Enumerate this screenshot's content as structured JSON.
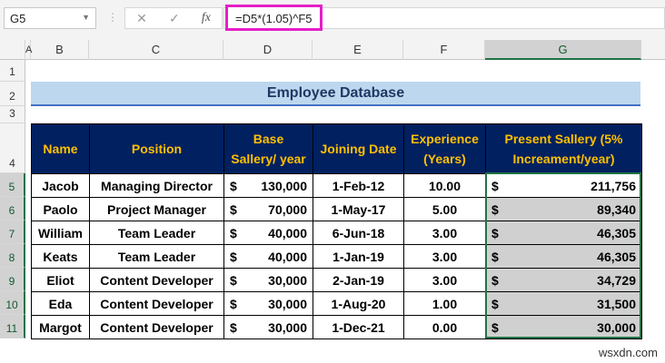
{
  "formula_bar": {
    "name_box": "G5",
    "cancel": "✕",
    "enter": "✓",
    "fx": "fx",
    "formula": "=D5*(1.05)^F5"
  },
  "columns": [
    "A",
    "B",
    "C",
    "D",
    "E",
    "F",
    "G"
  ],
  "rows": [
    "1",
    "2",
    "3",
    "4",
    "5",
    "6",
    "7",
    "8",
    "9",
    "10",
    "11"
  ],
  "title": "Employee Database",
  "headers": [
    "Name",
    "Position",
    "Base Sallery/ year",
    "Joining Date",
    "Experience (Years)",
    "Present Sallery (5% Increament/year)"
  ],
  "currency": "$",
  "data": [
    [
      "Jacob",
      "Managing Director",
      "130,000",
      "1-Feb-12",
      "10.00",
      "211,756"
    ],
    [
      "Paolo",
      "Project Manager",
      "70,000",
      "1-May-17",
      "5.00",
      "89,340"
    ],
    [
      "William",
      "Team Leader",
      "40,000",
      "6-Jun-18",
      "3.00",
      "46,305"
    ],
    [
      "Keats",
      "Team Leader",
      "40,000",
      "1-Jan-19",
      "3.00",
      "46,305"
    ],
    [
      "Eliot",
      "Content Developer",
      "30,000",
      "2-Jan-19",
      "3.00",
      "34,729"
    ],
    [
      "Eda",
      "Content Developer",
      "30,000",
      "1-Aug-20",
      "1.00",
      "31,500"
    ],
    [
      "Margot",
      "Content Developer",
      "30,000",
      "1-Dec-21",
      "0.00",
      "30,000"
    ]
  ],
  "watermark": "wsxdn.com"
}
